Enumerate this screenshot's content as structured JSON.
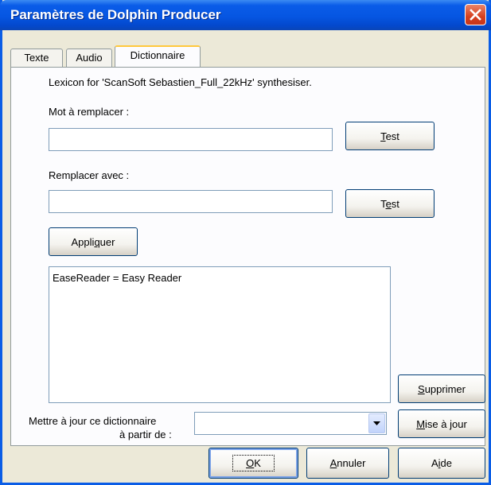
{
  "window": {
    "title": "Paramètres de Dolphin Producer"
  },
  "tabs": [
    {
      "label": "Texte"
    },
    {
      "label": "Audio"
    },
    {
      "label": "Dictionnaire"
    }
  ],
  "dictionary": {
    "lexicon_info": "Lexicon for 'ScanSoft Sebastien_Full_22kHz' synthesiser.",
    "word_to_replace_label": "Mot à remplacer :",
    "word_to_replace_value": "",
    "replace_with_label": "Remplacer avec :",
    "replace_with_value": "",
    "test_button_1": {
      "pre": "",
      "key": "T",
      "post": "est"
    },
    "test_button_2": {
      "pre": "T",
      "key": "e",
      "post": "st"
    },
    "apply_button": {
      "pre": "Appli",
      "key": "q",
      "post": "uer"
    },
    "entries": [
      "EaseReader = Easy Reader"
    ],
    "delete_button": {
      "pre": "",
      "key": "S",
      "post": "upprimer"
    },
    "update_from_label_line1": "Mettre à jour ce dictionnaire",
    "update_from_label_line2": "à partir de :",
    "update_from_value": "",
    "update_button": {
      "pre": "",
      "key": "M",
      "post": "ise à jour"
    }
  },
  "footer": {
    "ok_button": {
      "pre": "",
      "key": "O",
      "post": "K"
    },
    "cancel_button": {
      "pre": "",
      "key": "A",
      "post": "nnuler"
    },
    "help_button": {
      "pre": "A",
      "key": "i",
      "post": "de"
    }
  },
  "icons": {
    "close": "close-icon",
    "dropdown": "chevron-down-icon"
  },
  "colors": {
    "titlebar": "#0656e2",
    "close": "#d5401f",
    "dialog_bg": "#ece9d8",
    "active_tab_accent": "#ffc83c"
  }
}
